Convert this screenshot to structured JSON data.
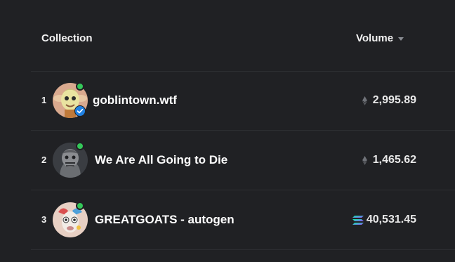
{
  "header": {
    "collection_label": "Collection",
    "volume_label": "Volume"
  },
  "rows": [
    {
      "rank": "1",
      "name": "goblintown.wtf",
      "volume": "2,995.89",
      "currency_icon": "eth-icon",
      "verified": true
    },
    {
      "rank": "2",
      "name": "We Are All Going to Die",
      "volume": "1,465.62",
      "currency_icon": "eth-icon",
      "verified": false
    },
    {
      "rank": "3",
      "name": "GREATGOATS - autogen",
      "volume": "40,531.45",
      "currency_icon": "solana-icon",
      "verified": false
    }
  ],
  "colors": {
    "background": "#202124",
    "divider": "#2d2f33",
    "online": "#34c759",
    "verified": "#2081e2"
  }
}
